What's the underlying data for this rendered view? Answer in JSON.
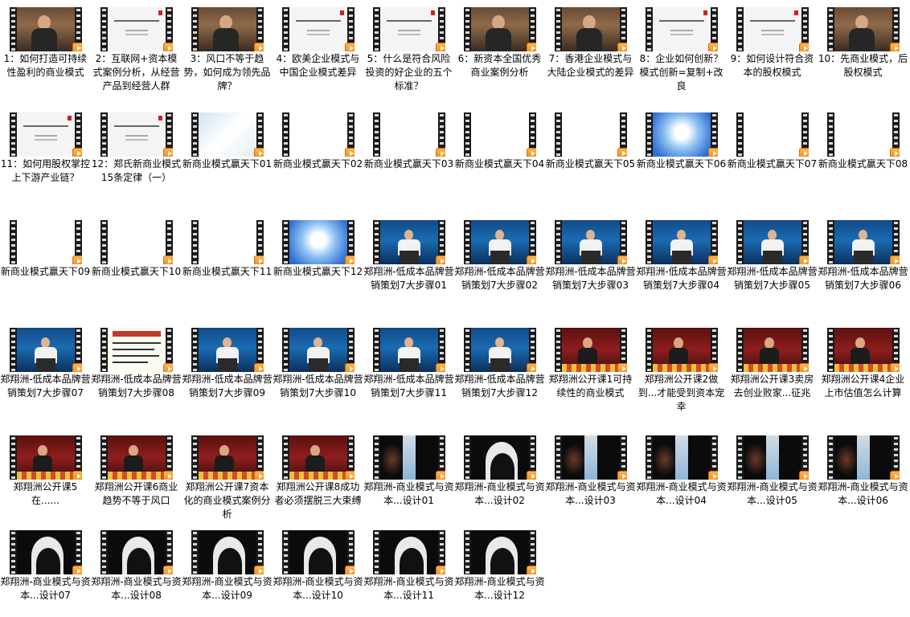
{
  "items": [
    {
      "label": "1：如何打造可持续性盈利的商业模式",
      "thumb": "person"
    },
    {
      "label": "2：互联网+资本模式案例分析，从经营产品到经营人群",
      "thumb": "doc"
    },
    {
      "label": "3：风口不等于趋势，如何成为领先品牌？",
      "thumb": "person"
    },
    {
      "label": "4：欧美企业模式与中国企业模式差异",
      "thumb": "doc"
    },
    {
      "label": "5：什么是符合风险投资的好企业的五个标准？",
      "thumb": "doc"
    },
    {
      "label": "6：新资本全国优秀商业案例分析",
      "thumb": "person"
    },
    {
      "label": "7：香港企业模式与大陆企业模式的差异",
      "thumb": "person"
    },
    {
      "label": "8：企业如何创新？模式创新=复制+改良",
      "thumb": "doc"
    },
    {
      "label": "9：如何设计符合资本的股权模式",
      "thumb": "doc"
    },
    {
      "label": "10：先商业模式，后股权模式",
      "thumb": "person"
    },
    {
      "label": "11：如何用股权掌控上下游产业链？",
      "thumb": "doc"
    },
    {
      "label": "12：郑氏新商业模式15条定律（一）",
      "thumb": "doc"
    },
    {
      "label": "新商业模式赢天下01",
      "thumb": "light"
    },
    {
      "label": "新商业模式赢天下02",
      "thumb": "white"
    },
    {
      "label": "新商业模式赢天下03",
      "thumb": "white"
    },
    {
      "label": "新商业模式赢天下04",
      "thumb": "white"
    },
    {
      "label": "新商业模式赢天下05",
      "thumb": "white"
    },
    {
      "label": "新商业模式赢天下06",
      "thumb": "glow"
    },
    {
      "label": "新商业模式赢天下07",
      "thumb": "white"
    },
    {
      "label": "新商业模式赢天下08",
      "thumb": "white"
    },
    {
      "label": "新商业模式赢天下09",
      "thumb": "white"
    },
    {
      "label": "新商业模式赢天下10",
      "thumb": "white"
    },
    {
      "label": "新商业模式赢天下11",
      "thumb": "white"
    },
    {
      "label": "新商业模式赢天下12",
      "thumb": "glow"
    },
    {
      "label": "郑翔洲-低成本品牌营销策划7大步骤01",
      "thumb": "speech"
    },
    {
      "label": "郑翔洲-低成本品牌营销策划7大步骤02",
      "thumb": "speech"
    },
    {
      "label": "郑翔洲-低成本品牌营销策划7大步骤03",
      "thumb": "speech"
    },
    {
      "label": "郑翔洲-低成本品牌营销策划7大步骤04",
      "thumb": "speech"
    },
    {
      "label": "郑翔洲-低成本品牌营销策划7大步骤05",
      "thumb": "speech"
    },
    {
      "label": "郑翔洲-低成本品牌营销策划7大步骤06",
      "thumb": "speech"
    },
    {
      "label": "郑翔洲-低成本品牌营销策划7大步骤07",
      "thumb": "speech"
    },
    {
      "label": "郑翔洲-低成本品牌营销策划7大步骤08",
      "thumb": "slidetext"
    },
    {
      "label": "郑翔洲-低成本品牌营销策划7大步骤09",
      "thumb": "speech"
    },
    {
      "label": "郑翔洲-低成本品牌营销策划7大步骤10",
      "thumb": "speech"
    },
    {
      "label": "郑翔洲-低成本品牌营销策划7大步骤11",
      "thumb": "speech"
    },
    {
      "label": "郑翔洲-低成本品牌营销策划7大步骤12",
      "thumb": "speech"
    },
    {
      "label": "郑翔洲公开课1可持续性的商业模式",
      "thumb": "stage"
    },
    {
      "label": "郑翔洲公开课2做到...才能受到资本宠幸",
      "thumb": "stage"
    },
    {
      "label": "郑翔洲公开课3卖房去创业败家...征兆",
      "thumb": "stage"
    },
    {
      "label": "郑翔洲公开课4企业上市估值怎么计算",
      "thumb": "stage"
    },
    {
      "label": "郑翔洲公开课5在......",
      "thumb": "stage"
    },
    {
      "label": "郑翔洲公开课6商业趋势不等于风口",
      "thumb": "stage"
    },
    {
      "label": "郑翔洲公开课7资本化的商业模式案例分析",
      "thumb": "stage"
    },
    {
      "label": "郑翔洲公开课8成功者必须摆脱三大束缚",
      "thumb": "stage"
    },
    {
      "label": "郑翔洲-商业模式与资本...设计01",
      "thumb": "dark"
    },
    {
      "label": "郑翔洲-商业模式与资本...设计02",
      "thumb": "dark2"
    },
    {
      "label": "郑翔洲-商业模式与资本...设计03",
      "thumb": "dark"
    },
    {
      "label": "郑翔洲-商业模式与资本...设计04",
      "thumb": "dark"
    },
    {
      "label": "郑翔洲-商业模式与资本...设计05",
      "thumb": "dark"
    },
    {
      "label": "郑翔洲-商业模式与资本...设计06",
      "thumb": "dark"
    },
    {
      "label": "郑翔洲-商业模式与资本...设计07",
      "thumb": "dark2"
    },
    {
      "label": "郑翔洲-商业模式与资本...设计08",
      "thumb": "dark2"
    },
    {
      "label": "郑翔洲-商业模式与资本...设计09",
      "thumb": "dark2"
    },
    {
      "label": "郑翔洲-商业模式与资本...设计10",
      "thumb": "dark2"
    },
    {
      "label": "郑翔洲-商业模式与资本...设计11",
      "thumb": "dark2"
    },
    {
      "label": "郑翔洲-商业模式与资本...设计12",
      "thumb": "dark2"
    }
  ]
}
